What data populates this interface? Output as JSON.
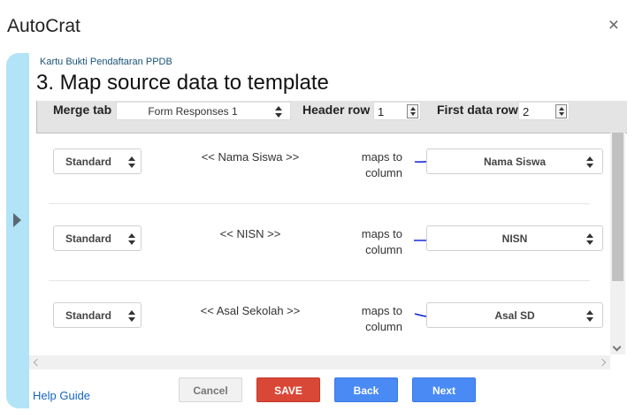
{
  "app": {
    "title": "AutoCrat",
    "close_icon": "×"
  },
  "breadcrumb": "Kartu Bukti Pendaftaran PPDB",
  "page_title": "3. Map source data to template",
  "merge_bar": {
    "merge_tab_label": "Merge tab",
    "merge_tab_value": "Form Responses 1",
    "header_row_label": "Header row",
    "header_row_value": "1",
    "first_data_row_label": "First data row",
    "first_data_row_value": "2"
  },
  "mappings": [
    {
      "type": "Standard",
      "tag": "<< Nama Siswa >>",
      "maps_to_line1": "maps to",
      "maps_to_line2": "column",
      "column": "Nama Siswa"
    },
    {
      "type": "Standard",
      "tag": "<< NISN >>",
      "maps_to_line1": "maps to",
      "maps_to_line2": "column",
      "column": "NISN"
    },
    {
      "type": "Standard",
      "tag": "<< Asal Sekolah >>",
      "maps_to_line1": "maps to",
      "maps_to_line2": "column",
      "column": "Asal SD"
    }
  ],
  "footer": {
    "help_link": "Help Guide",
    "cancel": "Cancel",
    "save": "SAVE",
    "back": "Back",
    "next": "Next"
  },
  "colors": {
    "save": "#d94837",
    "primary": "#4a8af4",
    "rail": "#b3e3f7",
    "annotation": "#1a2bd6"
  }
}
